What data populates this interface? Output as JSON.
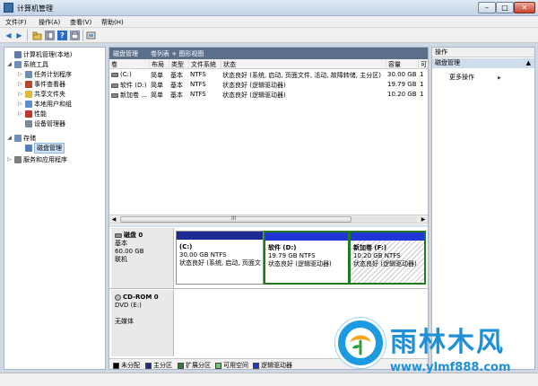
{
  "window": {
    "title": "计算机管理",
    "min_glyph": "–",
    "max_glyph": "□",
    "close_glyph": "✕"
  },
  "menu": [
    "文件(F)",
    "操作(A)",
    "查看(V)",
    "帮助(H)"
  ],
  "toolbar": {
    "back_glyph": "◀",
    "forward_glyph": "▶"
  },
  "tree": {
    "items": [
      {
        "label": "计算机管理(本地)",
        "twist": "",
        "color": "#5f7da8"
      },
      {
        "label": "系统工具",
        "twist": "◢",
        "color": "#6d8fb8"
      },
      {
        "label": "任务计划程序",
        "twist": "▷",
        "color": "#6a8fb5"
      },
      {
        "label": "事件查看器",
        "twist": "▷",
        "color": "#b6462c"
      },
      {
        "label": "共享文件夹",
        "twist": "▷",
        "color": "#e0b93d"
      },
      {
        "label": "本地用户和组",
        "twist": "▷",
        "color": "#5c8fc8"
      },
      {
        "label": "性能",
        "twist": "▷",
        "color": "#c0392b"
      },
      {
        "label": "设备管理器",
        "twist": "",
        "color": "#7a8a99"
      },
      {
        "label": "存储",
        "twist": "◢",
        "color": "#6d8fb8"
      },
      {
        "label": "磁盘管理",
        "twist": "",
        "color": "#4f7fbf"
      },
      {
        "label": "服务和应用程序",
        "twist": "▷",
        "color": "#7e7e7e"
      }
    ]
  },
  "center": {
    "tabs": [
      "磁盘管理",
      "卷列表 + 图形视图"
    ],
    "columns": [
      "卷",
      "布局",
      "类型",
      "文件系统",
      "状态",
      "容量",
      "可"
    ],
    "rows": [
      [
        "(C:)",
        "简单",
        "基本",
        "NTFS",
        "状态良好 (系统, 启动, 页面文件, 活动, 故障转储, 主分区)",
        "30.00 GB",
        "1"
      ],
      [
        "软件 (D:)",
        "简单",
        "基本",
        "NTFS",
        "状态良好 (逻辑驱动器)",
        "19.79 GB",
        "1"
      ],
      [
        "新加卷 ...",
        "简单",
        "基本",
        "NTFS",
        "状态良好 (逻辑驱动器)",
        "10.20 GB",
        "1"
      ]
    ],
    "scroll": {
      "left": "◀",
      "right": "▶",
      "grip": "III"
    }
  },
  "disk0": {
    "name": "磁盘 0",
    "type": "基本",
    "size": "60.00 GB",
    "status": "联机",
    "partitions": [
      {
        "name": "(C:)",
        "size": "30.00 GB NTFS",
        "status": "状态良好 (系统, 启动, 页面文",
        "bar": "#1e2a93"
      },
      {
        "name": "软件  (D:)",
        "size": "19.79 GB NTFS",
        "status": "状态良好 (逻辑驱动器)",
        "bar": "#2136d6"
      },
      {
        "name": "新加卷  (F:)",
        "size": "10.20 GB NTFS",
        "status": "状态良好 (逻辑驱动器)",
        "bar": "#2136d6"
      }
    ]
  },
  "cdrom": {
    "name": "CD-ROM 0",
    "type": "DVD (E:)",
    "status": "无媒体"
  },
  "legend": [
    {
      "label": "未分配",
      "color": "#000000"
    },
    {
      "label": "主分区",
      "color": "#1e2a93"
    },
    {
      "label": "扩展分区",
      "color": "#2e7d32"
    },
    {
      "label": "可用空间",
      "color": "#62d162"
    },
    {
      "label": "逻辑驱动器",
      "color": "#2136d6"
    }
  ],
  "actions": {
    "header": "操作",
    "section": "磁盘管理",
    "section_caret": "▲",
    "more": "更多操作"
  },
  "watermark": {
    "text": "雨林木风",
    "url": "www.ylmf888.com"
  }
}
